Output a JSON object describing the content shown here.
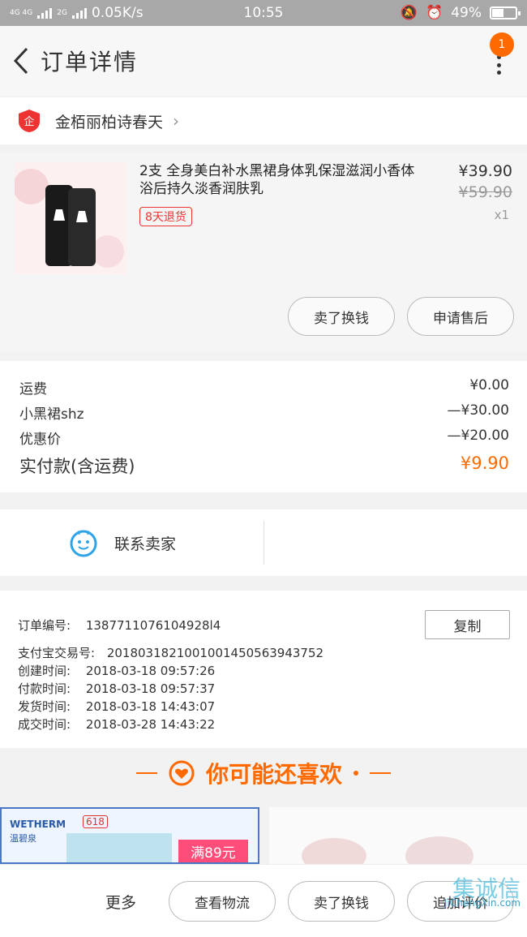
{
  "status_bar": {
    "network": "4G 4G",
    "network2": "2G",
    "speed": "0.05K/s",
    "time": "10:55",
    "battery": "49%",
    "battery_level": 0.49
  },
  "nav": {
    "title": "订单详情",
    "badge": "1"
  },
  "shop": {
    "name": "金栢丽柏诗春天",
    "logo_text": "企"
  },
  "product": {
    "title": "2支 全身美白补水黑裙身体乳保湿滋润小香体浴后持久淡香润肤乳",
    "tag": "8天退货",
    "price": "¥39.90",
    "original_price": "¥59.90",
    "quantity": "x1",
    "buttons": [
      "卖了换钱",
      "申请售后"
    ]
  },
  "fees": [
    {
      "label": "运费",
      "value": "¥0.00"
    },
    {
      "label": "小黑裙shz",
      "value": "—¥30.00"
    },
    {
      "label": "优惠价",
      "value": "—¥20.00"
    },
    {
      "label": "实付款(含运费)",
      "value": "¥9.90"
    }
  ],
  "contact": {
    "label": "联系卖家"
  },
  "order": {
    "number_label": "订单编号:",
    "number": "1387711076104928l4",
    "copy_label": "复制",
    "rows": [
      {
        "label": "支付宝交易号:",
        "value": "2018031821001001450563943752"
      },
      {
        "label": "创建时间:",
        "value": "2018-03-18 09:57:26"
      },
      {
        "label": "付款时间:",
        "value": "2018-03-18 09:57:37"
      },
      {
        "label": "发货时间:",
        "value": "2018-03-18 14:43:07"
      },
      {
        "label": "成交时间:",
        "value": "2018-03-28 14:43:22"
      }
    ]
  },
  "recommend": {
    "title": "你可能还喜欢",
    "card1_brand": "WETHERM",
    "card1_brand_cn": "温碧泉",
    "card1_tag": "618",
    "card1_promo": "满89元"
  },
  "bottom_bar": {
    "more": "更多",
    "buttons": [
      "查看物流",
      "卖了换钱",
      "追加评价"
    ]
  },
  "watermark": {
    "logo": "集诚信",
    "site": "JiChengXin.com"
  },
  "colors": {
    "accent": "#ff6a00",
    "tag_red": "#e33333",
    "status_bar": "#a8a8a8"
  }
}
